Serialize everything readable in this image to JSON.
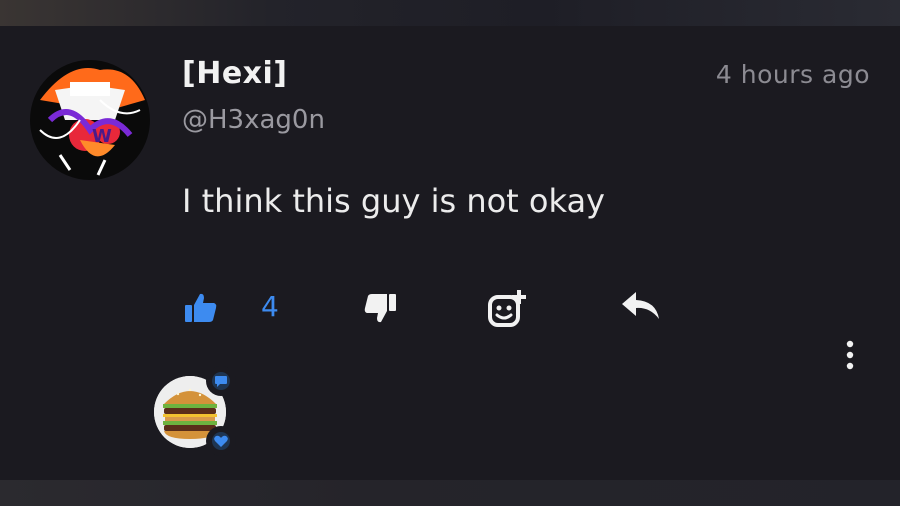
{
  "comment": {
    "author": {
      "display_name": "[Hexi]",
      "handle": "@H3xag0n"
    },
    "timestamp": "4 hours ago",
    "text": "I think this guy is not okay",
    "actions": {
      "like_count": "4"
    }
  },
  "icons": {
    "like": "thumbs-up-icon",
    "dislike": "thumbs-down-icon",
    "react": "add-emoji-icon",
    "reply": "reply-arrow-icon",
    "more": "more-vertical-icon",
    "reply_badge": "chat-bubble-icon",
    "heart_badge": "heart-icon"
  },
  "colors": {
    "background": "#1b1a20",
    "accent": "#3d8bf0",
    "text_primary": "#f2f2f2",
    "text_secondary": "#9a99a0"
  }
}
